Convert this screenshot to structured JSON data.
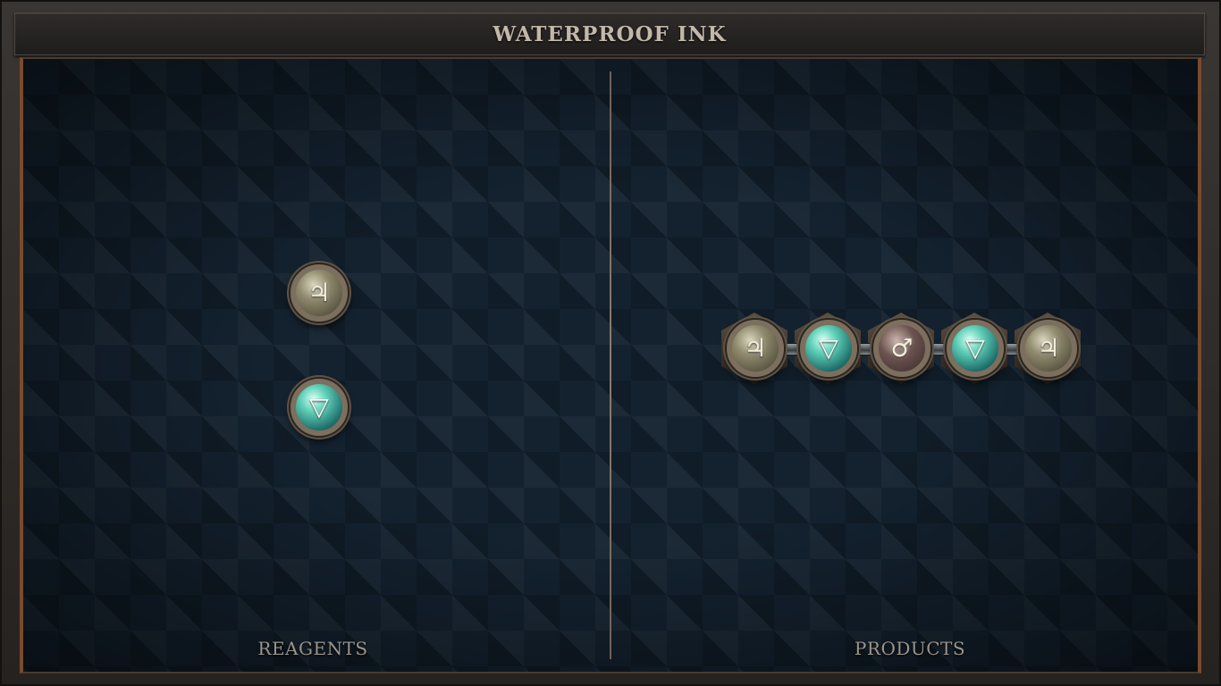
{
  "title": "WATERPROOF INK",
  "panels": {
    "reagents_label": "REAGENTS",
    "products_label": "PRODUCTS"
  },
  "reagents": [
    {
      "element": "salt",
      "symbol": "♃",
      "icon": "salt-glyph-icon"
    },
    {
      "element": "water",
      "symbol": "▽",
      "icon": "water-glyph-icon"
    }
  ],
  "product": {
    "atoms": [
      {
        "element": "salt",
        "symbol": "♃"
      },
      {
        "element": "water",
        "symbol": "▽"
      },
      {
        "element": "iron",
        "symbol": "♂"
      },
      {
        "element": "water",
        "symbol": "▽"
      },
      {
        "element": "salt",
        "symbol": "♃"
      }
    ],
    "bonds": 4
  },
  "colors": {
    "board": "#142230",
    "frame": "#2a2624",
    "accent_copper": "#7a4a2c",
    "title_text": "#c2b8a9"
  }
}
